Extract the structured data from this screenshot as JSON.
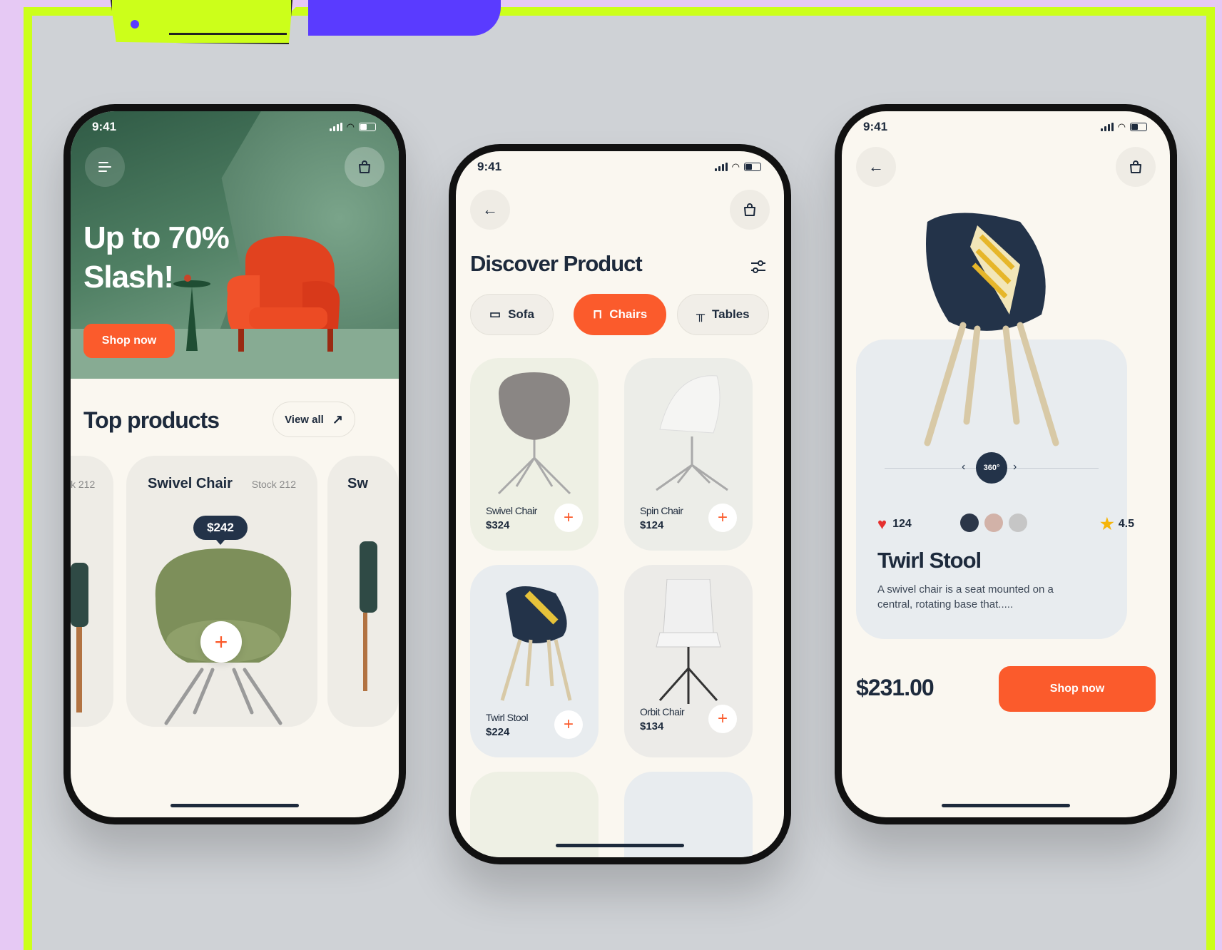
{
  "status_time": "9:41",
  "colors": {
    "accent": "#fb5b2c",
    "navy": "#1d2a3c",
    "frame": "#ccff1a",
    "backdrop": "#e6c9f4"
  },
  "phone1": {
    "hero_line1": "Up to 70%",
    "hero_line2": "Slash!",
    "hero_button": "Shop now",
    "section_title": "Top products",
    "view_all": "View all",
    "left_card_stock": "k 212",
    "card": {
      "name": "Swivel Chair",
      "stock": "Stock 212",
      "price": "$242"
    },
    "right_card_name": "Sw"
  },
  "phone2": {
    "title": "Discover Product",
    "chips": [
      {
        "label": "Sofa",
        "icon": "sofa-icon"
      },
      {
        "label": "Chairs",
        "icon": "armchair-icon"
      },
      {
        "label": "Tables",
        "icon": "table-icon"
      }
    ],
    "products": [
      {
        "name": "Swivel Chair",
        "price": "$324"
      },
      {
        "name": "Spin Chair",
        "price": "$124"
      },
      {
        "name": "Twirl Stool",
        "price": "$224"
      },
      {
        "name": "Orbit Chair",
        "price": "$134"
      }
    ]
  },
  "phone3": {
    "rotate_label": "360°",
    "likes": "124",
    "rating": "4.5",
    "swatch_colors": [
      "#2b3648",
      "#d2b2a8",
      "#c6c6c6"
    ],
    "title": "Twirl Stool",
    "description": "A swivel chair is a seat mounted on a central, rotating base that.....",
    "price": "$231.00",
    "button": "Shop now"
  }
}
